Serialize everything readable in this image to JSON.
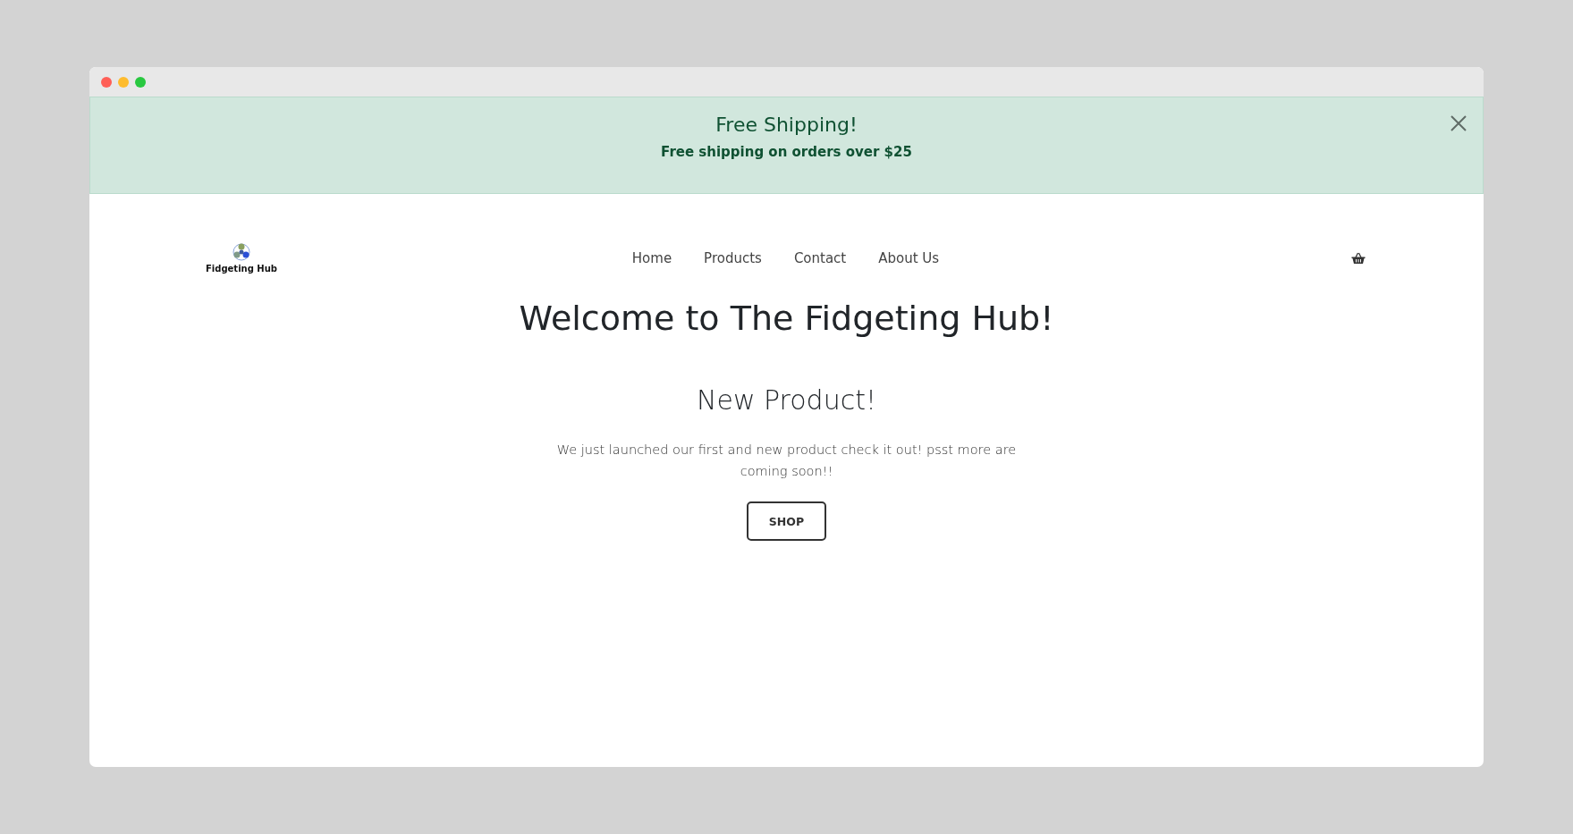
{
  "announcement": {
    "title": "Free Shipping!",
    "message": "Free shipping on orders over $25"
  },
  "header": {
    "brand": "Fidgeting Hub",
    "nav": [
      "Home",
      "Products",
      "Contact",
      "About Us"
    ]
  },
  "hero": {
    "title": "Welcome to The Fidgeting Hub!"
  },
  "feature": {
    "title": "New Product!",
    "text": "We just launched our first and new product check it out! psst more are coming soon!!",
    "button": "SHOP"
  }
}
